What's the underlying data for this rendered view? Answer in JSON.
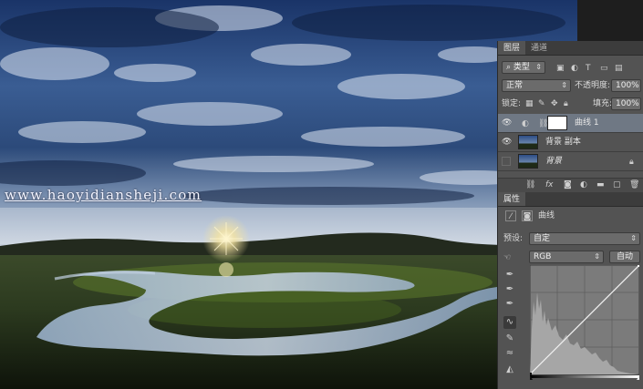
{
  "watermark": "www.haoyidiansheji.com",
  "colors": {
    "panel_bg": "#535353",
    "selected_layer": "#6f7884",
    "sky": "#1f3a6e"
  },
  "layers_panel": {
    "tabs": [
      "图层",
      "通道"
    ],
    "filter_label": "类型",
    "blend_mode": "正常",
    "opacity_label": "不透明度:",
    "opacity_value": "100%",
    "lock_label": "锁定:",
    "fill_label": "填充:",
    "fill_value": "100%",
    "layers": [
      {
        "name": "曲线 1",
        "visible": true,
        "selected": true
      },
      {
        "name": "背景 副本",
        "visible": true,
        "selected": false
      },
      {
        "name": "背景",
        "visible": false,
        "selected": false,
        "locked": true
      }
    ],
    "bottom_icons": [
      "link-icon",
      "fx-icon",
      "mask-icon",
      "adjustment-icon",
      "group-icon",
      "new-layer-icon",
      "trash-icon"
    ]
  },
  "properties_panel": {
    "tab": "属性",
    "adjustment_name": "曲线",
    "preset_label": "预设:",
    "preset_value": "自定",
    "channel_value": "RGB",
    "auto_button": "自动"
  }
}
